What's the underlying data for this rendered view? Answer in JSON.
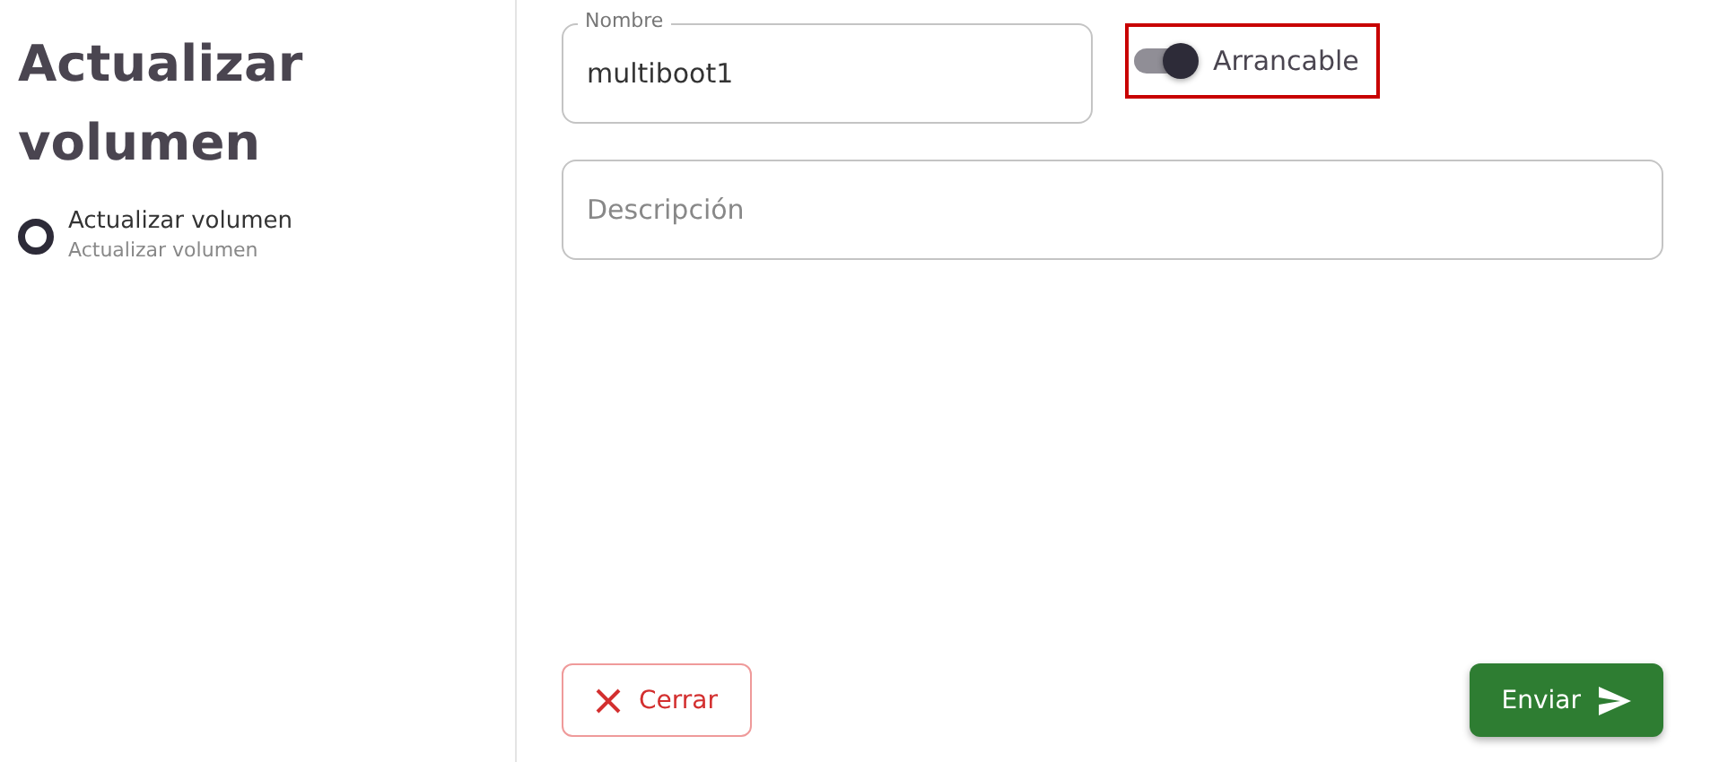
{
  "sidebar": {
    "title": "Actualizar volumen",
    "steps": [
      {
        "label": "Actualizar volumen",
        "caption": "Actualizar volumen",
        "selected": true
      }
    ]
  },
  "form": {
    "name_field": {
      "label": "Nombre",
      "value": "multiboot1"
    },
    "bootable_switch": {
      "label": "Arrancable",
      "on": true,
      "focused": true
    },
    "description_field": {
      "placeholder": "Descripción"
    }
  },
  "buttons": [
    {
      "kind": "cancel",
      "label": "Cerrar"
    },
    {
      "kind": "submit",
      "label": "Enviar"
    }
  ]
}
